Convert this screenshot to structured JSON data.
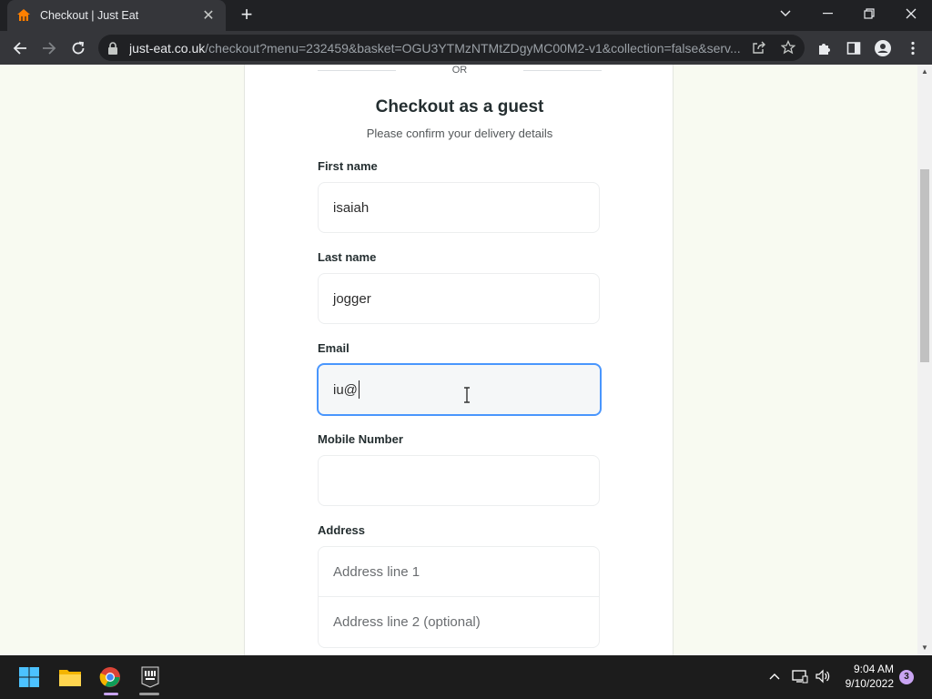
{
  "browser": {
    "tab_title": "Checkout | Just Eat",
    "url_host": "just-eat.co.uk",
    "url_rest": "/checkout?menu=232459&basket=OGU3YTMzNTMtZDgyMC00M2-v1&collection=false&serv...",
    "favicon_color": "#ff8000"
  },
  "page": {
    "or_text": "OR",
    "heading": "Checkout as a guest",
    "subheading": "Please confirm your delivery details",
    "first_name": {
      "label": "First name",
      "value": "isaiah"
    },
    "last_name": {
      "label": "Last name",
      "value": "jogger"
    },
    "email": {
      "label": "Email",
      "value": "iu@"
    },
    "mobile": {
      "label": "Mobile Number",
      "value": ""
    },
    "address": {
      "label": "Address",
      "line1_placeholder": "Address line 1",
      "line2_placeholder": "Address line 2 (optional)"
    },
    "focus_color": "#4996fd"
  },
  "taskbar": {
    "time": "9:04 AM",
    "date": "9/10/2022",
    "notification_count": "3",
    "apps": [
      "windows-start",
      "file-explorer",
      "google-chrome",
      "epic-games-launcher"
    ]
  }
}
